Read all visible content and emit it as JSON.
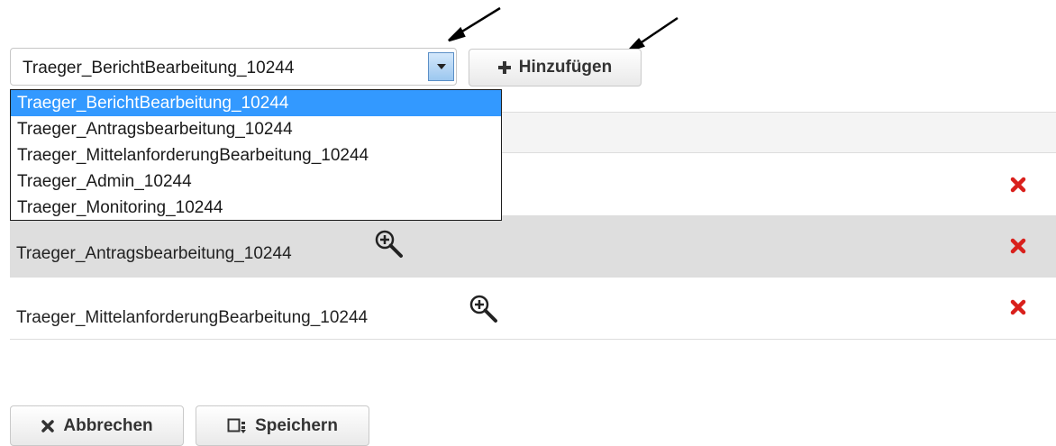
{
  "role_select": {
    "selected": "Traeger_BerichtBearbeitung_10244",
    "options": [
      "Traeger_BerichtBearbeitung_10244",
      "Traeger_Antragsbearbeitung_10244",
      "Traeger_MittelanforderungBearbeitung_10244",
      "Traeger_Admin_10244",
      "Traeger_Monitoring_10244"
    ]
  },
  "add_button": {
    "label": "Hinzufügen",
    "icon": "plus-icon"
  },
  "table": {
    "rows": [
      {
        "label": "",
        "zoom_icon": "zoom-in-icon",
        "delete_icon": "delete-icon"
      },
      {
        "label": "Traeger_Antragsbearbeitung_10244",
        "zoom_icon": "zoom-in-icon",
        "delete_icon": "delete-icon"
      },
      {
        "label": "Traeger_MittelanforderungBearbeitung_10244",
        "zoom_icon": "zoom-in-icon",
        "delete_icon": "delete-icon"
      }
    ]
  },
  "footer": {
    "cancel_label": "Abbrechen",
    "save_label": "Speichern"
  },
  "colors": {
    "selected_option": "#3399ff",
    "delete_icon": "#d9201c",
    "row_highlight": "#dedede"
  }
}
